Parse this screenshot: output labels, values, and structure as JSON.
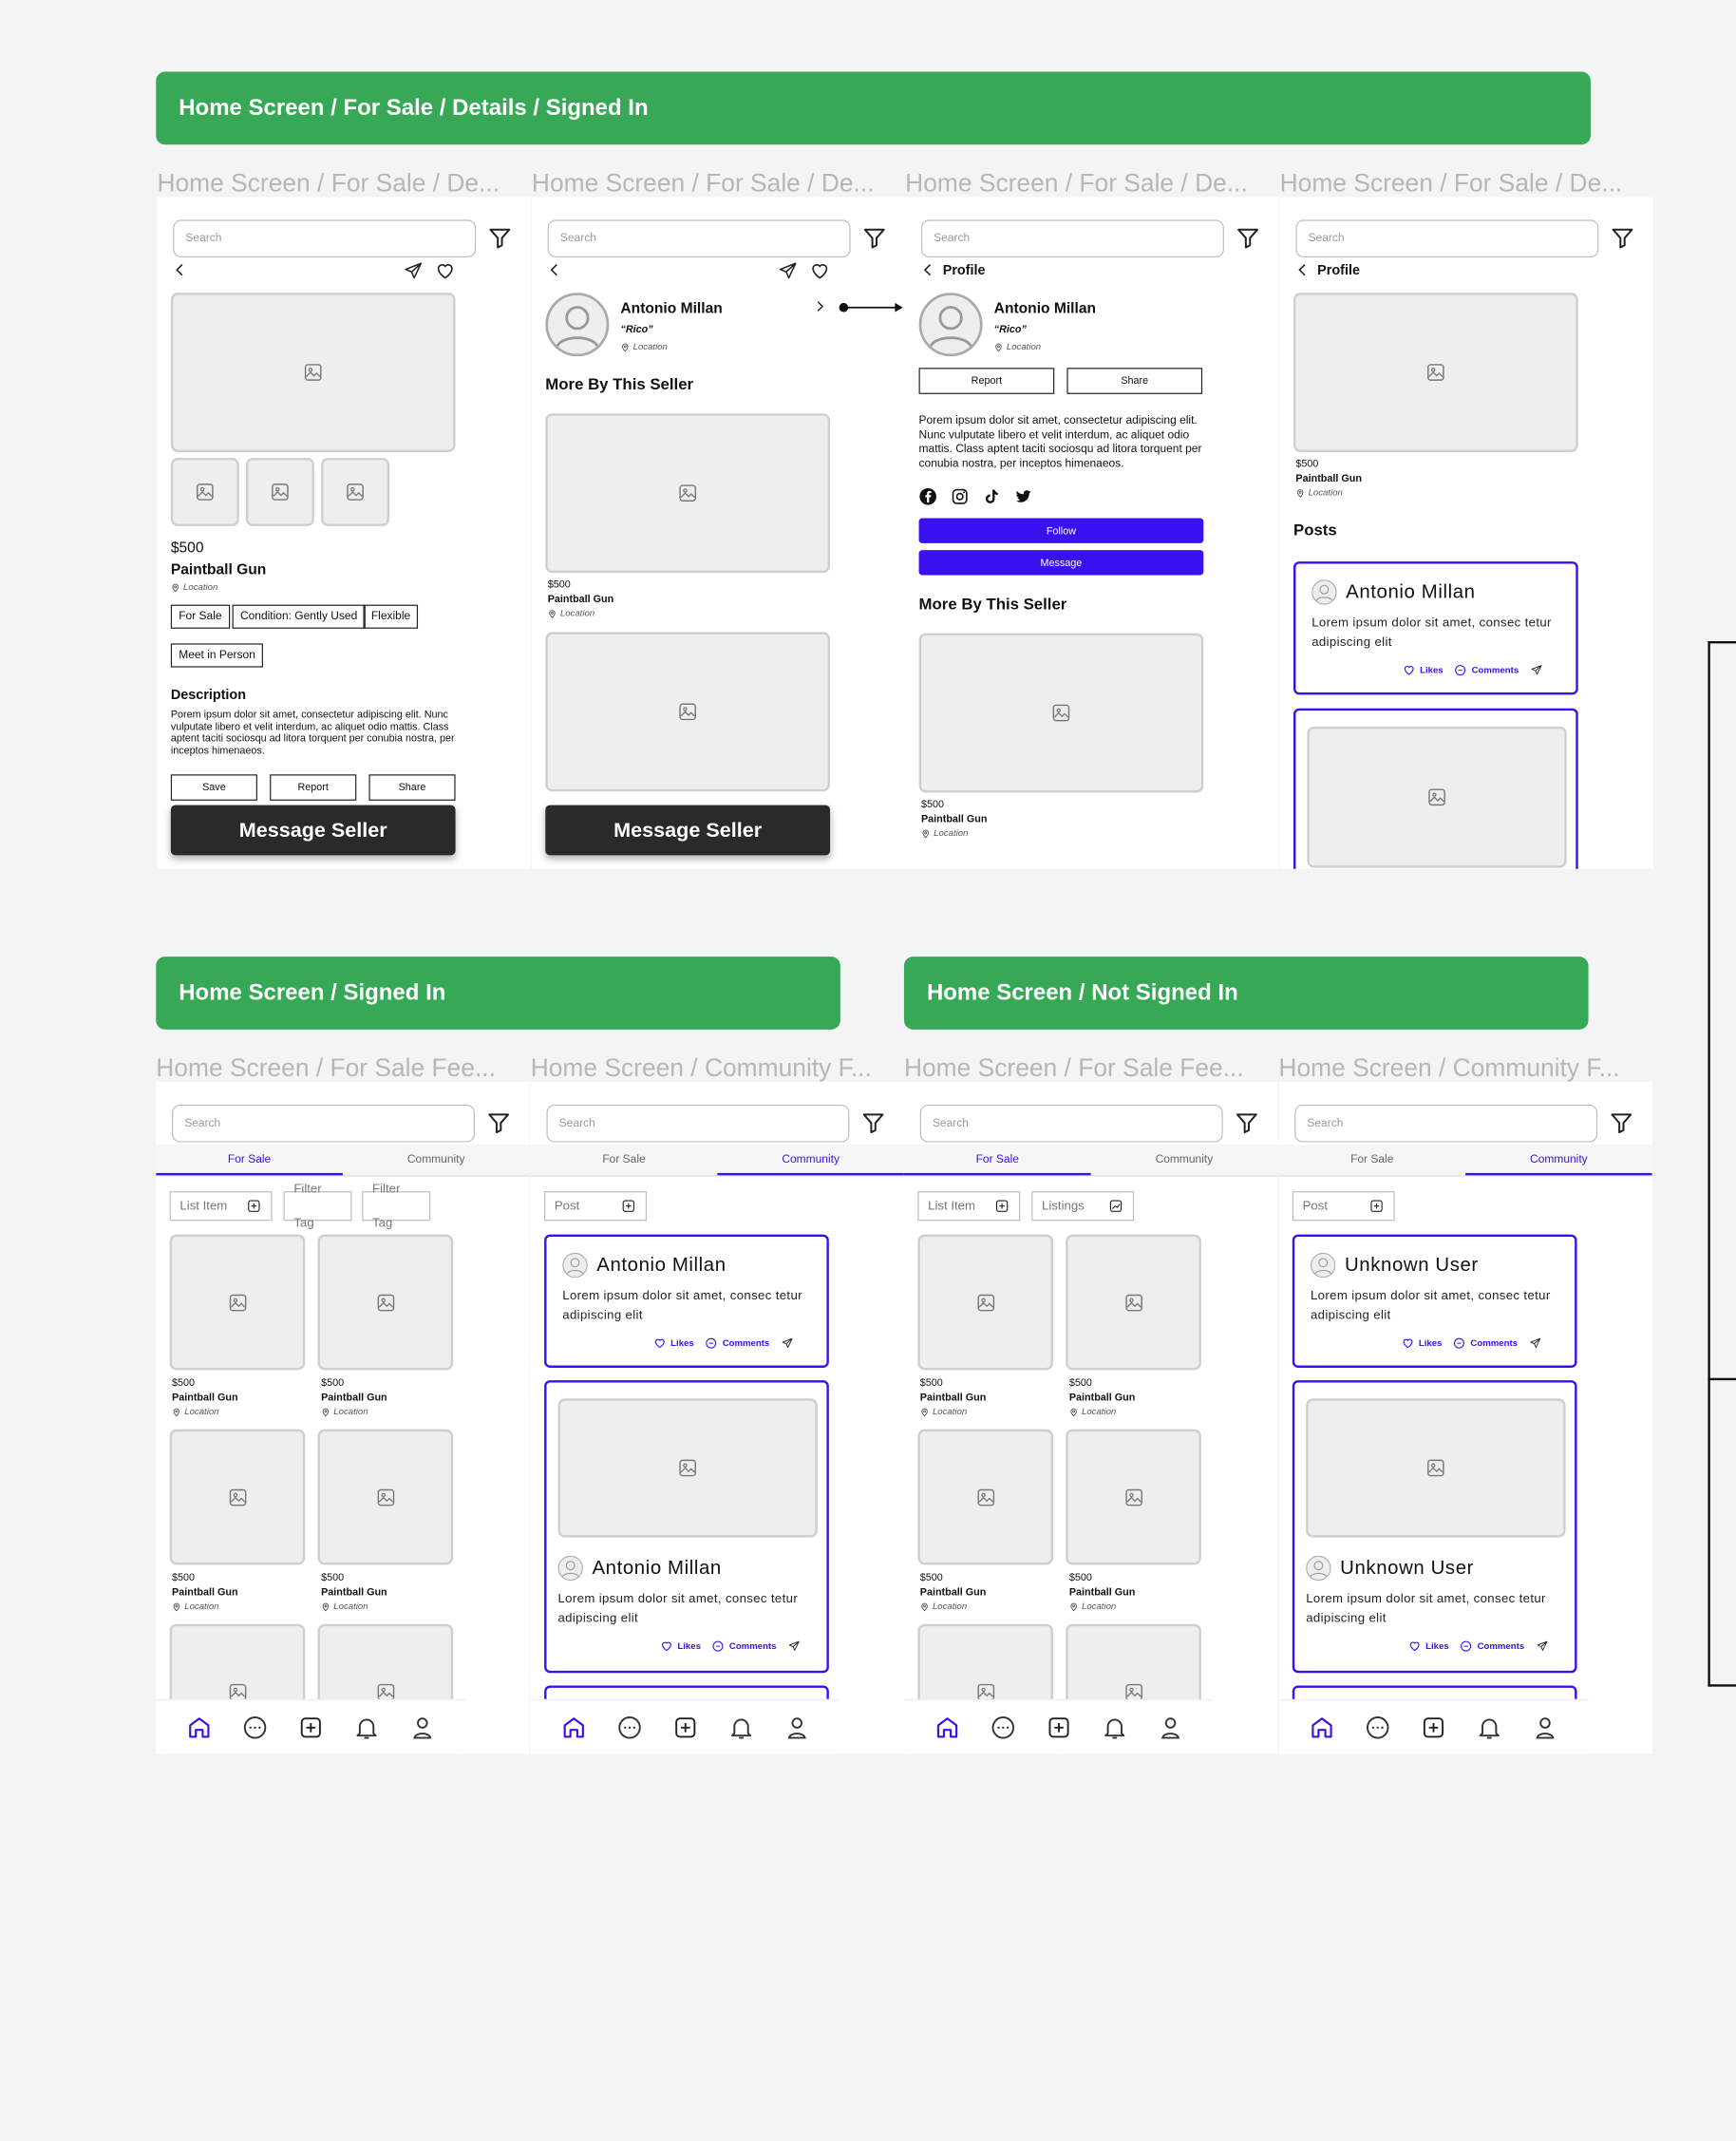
{
  "banners": {
    "top": "Home Screen / For Sale /  Details /  Signed In",
    "signed_in": "Home Screen / Signed In",
    "not_signed_in": "Home Screen / Not Signed In"
  },
  "frame_titles": [
    "Home Screen / For Sale / De...",
    "Home Screen / For Sale / De...",
    "Home Screen / For Sale / De...",
    "Home Screen / For Sale / De...",
    "Home Screen / For Sale Fee...",
    "Home Screen / Community F...",
    "Home Screen / For Sale Fee...",
    "Home Screen / Community F..."
  ],
  "common": {
    "search_placeholder": "Search",
    "price": "$500",
    "product": "Paintball Gun",
    "location": "Location",
    "message_seller": "Message Seller",
    "more_by_seller": "More By This Seller",
    "profile": "Profile",
    "posts": "Posts",
    "likes": "Likes",
    "comments": "Comments",
    "description_heading": "Description"
  },
  "details": {
    "tags": [
      "For Sale",
      "Condition: Gently Used",
      "Flexible",
      "Meet in Person"
    ],
    "description": "Porem ipsum dolor sit amet, consectetur adipiscing elit. Nunc vulputate libero et velit interdum, ac aliquet odio mattis. Class aptent taciti sociosqu ad litora torquent per conubia nostra, per inceptos himenaeos.",
    "buttons": [
      "Save",
      "Report",
      "Share"
    ]
  },
  "seller": {
    "name": "Antonio Millan",
    "nickname": "“Rico”",
    "location": "Location",
    "bio": "Porem ipsum dolor sit amet, consectetur adipiscing elit. Nunc vulputate libero et velit interdum, ac aliquet odio mattis. Class aptent taciti sociosqu ad litora torquent per conubia nostra, per inceptos himenaeos.",
    "report": "Report",
    "share": "Share",
    "follow": "Follow",
    "message": "Message",
    "socials": [
      "facebook-icon",
      "instagram-icon",
      "tiktok-icon",
      "twitter-icon"
    ]
  },
  "post": {
    "author": "Antonio Millan",
    "unknown_author": "Unknown User",
    "text": "Lorem ipsum dolor sit amet, consec tetur adipiscing elit"
  },
  "feed": {
    "tabs": [
      "For Sale",
      "Community"
    ],
    "list_item": "List Item",
    "filter_tag": "Filter Tag",
    "listings": "Listings",
    "post_label": "Post"
  },
  "nav": [
    "home-icon",
    "chat-icon",
    "add-icon",
    "bell-icon",
    "user-icon"
  ],
  "colors": {
    "green": "#36a856",
    "purple": "#3a0ff0",
    "dark": "#2a2a2a"
  }
}
